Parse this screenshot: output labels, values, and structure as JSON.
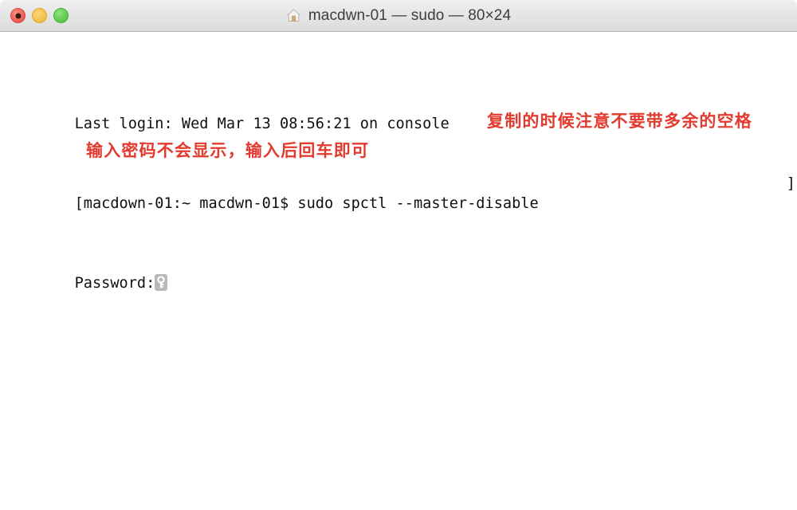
{
  "window": {
    "title": "macdwn-01 — sudo — 80×24",
    "title_icon": "home-icon",
    "controls": {
      "close_label": "",
      "minimize_label": "",
      "maximize_label": ""
    }
  },
  "terminal": {
    "lines": [
      "Last login: Wed Mar 13 08:56:21 on console",
      "[macdown-01:~ macdwn-01$ sudo spctl --master-disable",
      "Password:"
    ],
    "wrap_marker": "]",
    "password_icon": "key-icon",
    "columns": "80",
    "rows": "24"
  },
  "annotations": [
    {
      "text": "复制的时候注意不要带多余的空格",
      "color": "#e23a2e",
      "name": "annotation-copy-warning"
    },
    {
      "text": "输入密码不会显示，输入后回车即可",
      "color": "#e23a2e",
      "name": "annotation-password-hint"
    }
  ]
}
